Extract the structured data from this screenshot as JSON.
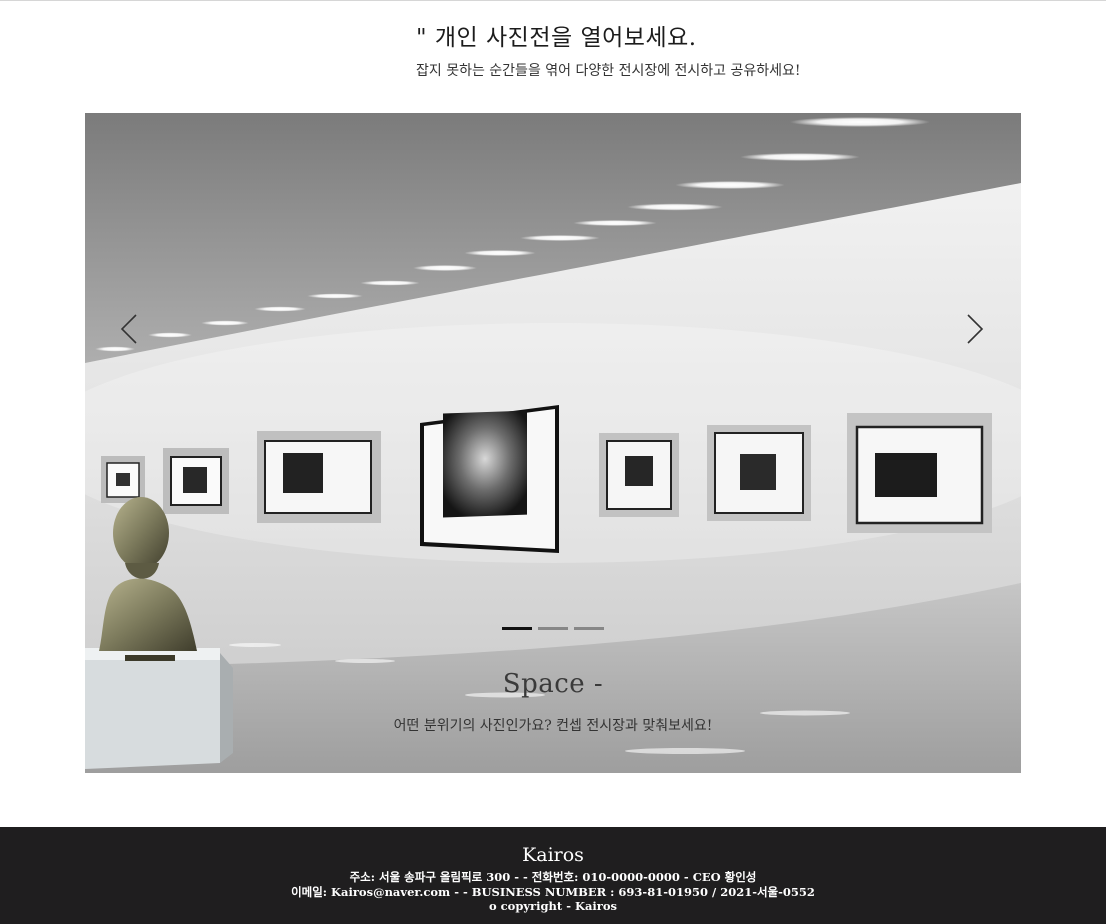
{
  "intro": {
    "title": "\" 개인 사진전을 열어보세요.",
    "subtitle": "잡지 못하는 순간들을 엮어 다양한 전시장에 전시하고 공유하세요!"
  },
  "carousel": {
    "prev_icon": "chevron-left-icon",
    "next_icon": "chevron-right-icon",
    "slide_count": 3,
    "active_slide": 1,
    "caption_title": "Space -",
    "caption_text": "어떤 분위기의 사진인가요? 컨셉 전시장과 맞춰보세요!"
  },
  "footer": {
    "brand": "Kairos",
    "line1": "주소: 서울 송파구 올림픽로 300 - - 전화번호: 010-0000-0000 - CEO 황인성",
    "line2": "이메일: Kairos@naver.com - - BUSINESS NUMBER : 693-81-01950 / 2021-서울-0552",
    "line3": "o copyright - Kairos"
  }
}
